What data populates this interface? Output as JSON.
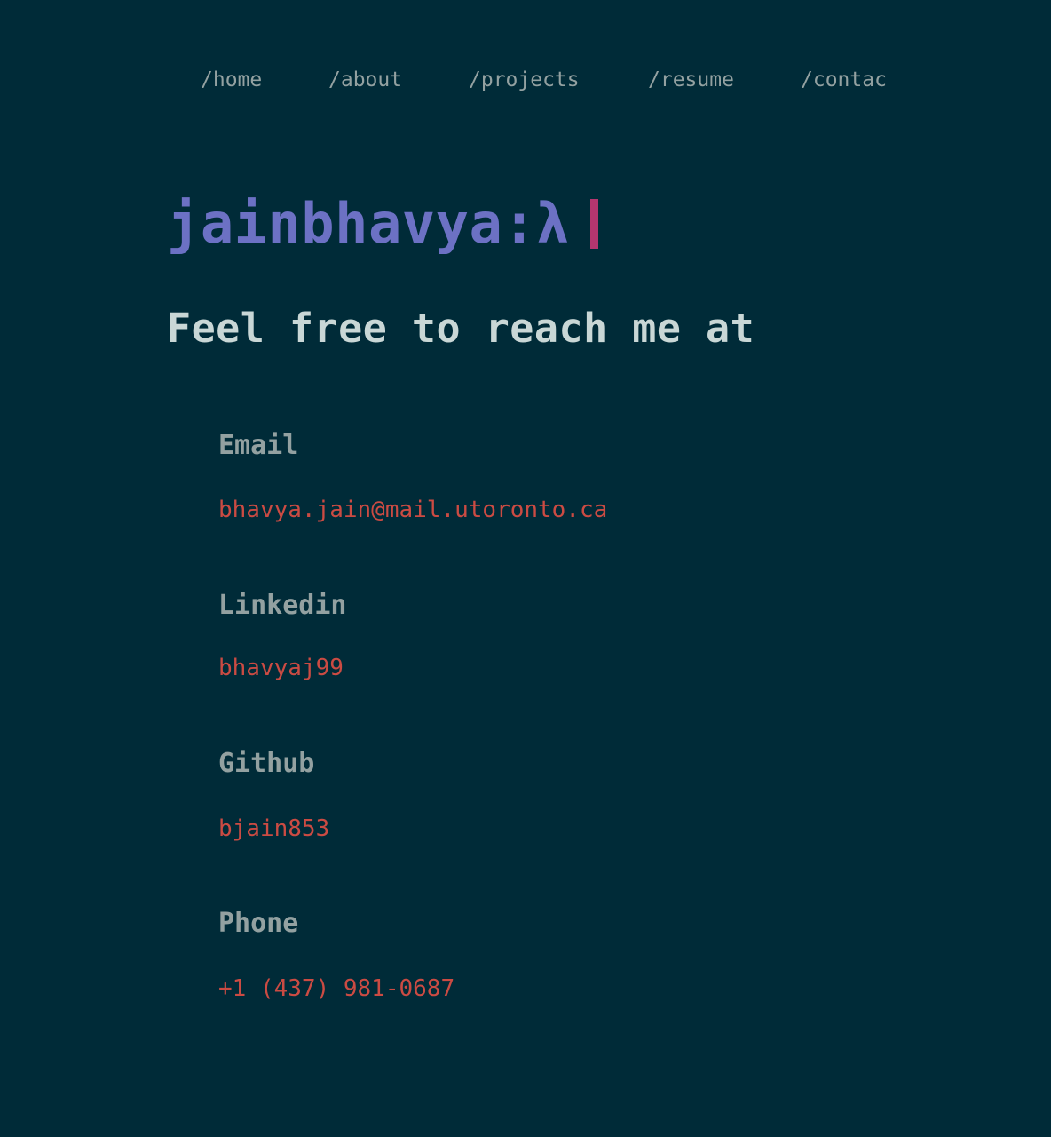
{
  "nav": {
    "home": "/home",
    "about": "/about",
    "projects": "/projects",
    "resume": "/resume",
    "contact": "/contact"
  },
  "brand": {
    "text": "jainbhavya:λ",
    "accent_color": "#6c71c4",
    "cursor_color": "#b5366f"
  },
  "heading": "Feel free to reach me at",
  "contacts": {
    "email": {
      "label": "Email",
      "value": "bhavya.jain@mail.utoronto.ca"
    },
    "linkedin": {
      "label": "Linkedin",
      "value": "bhavyaj99"
    },
    "github": {
      "label": "Github",
      "value": "bjain853"
    },
    "phone": {
      "label": "Phone",
      "value": "+1 (437) 981-0687"
    }
  },
  "colors": {
    "background": "#002b38",
    "nav_text": "#93a1a1",
    "heading_text": "#c9d7d6",
    "label_text": "#93a1a1",
    "value_text": "#cb4b43"
  }
}
